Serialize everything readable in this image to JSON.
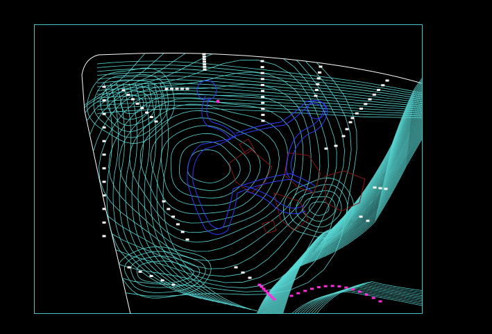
{
  "drawing": {
    "kind": "site topographic plan (CAD model space)",
    "background": "#000000",
    "colors": {
      "frame": "#43c6c6",
      "contour": "#58d8d4",
      "boundary": "#ffffff",
      "contour_labels": "#ffffff",
      "road_edges": "#2f3cff",
      "buildings": "#8a1616",
      "pink_markers": "#ff2bd8"
    },
    "layers": [
      "frame",
      "property-boundary",
      "contours",
      "roads",
      "buildings",
      "contour-labels",
      "markers"
    ]
  }
}
